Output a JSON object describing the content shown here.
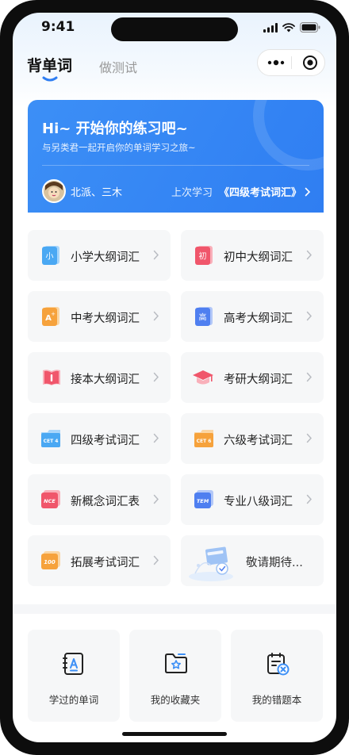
{
  "status": {
    "time": "9:41"
  },
  "tabs": {
    "active": "背单词",
    "inactive": "做测试"
  },
  "banner": {
    "title": "Hi~ 开始你的练习吧~",
    "subtitle": "与另类君一起开启你的单词学习之旅~",
    "authors": "北派、三木",
    "last_study_label": "上次学习",
    "last_study_book": "《四级考试词汇》"
  },
  "categories": [
    {
      "label": "小学大纲词汇",
      "icon": "xiao-icon",
      "icon_text": "小",
      "color": "#4aa8f3"
    },
    {
      "label": "初中大纲词汇",
      "icon": "chu-icon",
      "icon_text": "初",
      "color": "#f0566b"
    },
    {
      "label": "中考大纲词汇",
      "icon": "a-plus-icon",
      "icon_text": "A⁺",
      "color": "#f6a23c"
    },
    {
      "label": "高考大纲词汇",
      "icon": "gao-icon",
      "icon_text": "高",
      "color": "#4f7ff0"
    },
    {
      "label": "接本大纲词汇",
      "icon": "book-icon",
      "icon_text": "",
      "color": "#f0566b"
    },
    {
      "label": "考研大纲词汇",
      "icon": "graduation-cap-icon",
      "icon_text": "",
      "color": "#f0566b"
    },
    {
      "label": "四级考试词汇",
      "icon": "cet4-icon",
      "icon_text": "CET 4",
      "color": "#4aa8f3"
    },
    {
      "label": "六级考试词汇",
      "icon": "cet6-icon",
      "icon_text": "CET 6",
      "color": "#f6a23c"
    },
    {
      "label": "新概念词汇表",
      "icon": "nce-icon",
      "icon_text": "NCE",
      "color": "#f0566b"
    },
    {
      "label": "专业八级词汇",
      "icon": "tem-icon",
      "icon_text": "TEM",
      "color": "#4f7ff0"
    },
    {
      "label": "拓展考试词汇",
      "icon": "score-100-icon",
      "icon_text": "100",
      "color": "#f6a23c"
    },
    {
      "label": "敬请期待...",
      "icon": "coming-soon-illustration-icon",
      "icon_text": "",
      "color": "#9fc3f5"
    }
  ],
  "bottom": [
    {
      "label": "学过的单词",
      "icon": "learned-words-icon"
    },
    {
      "label": "我的收藏夹",
      "icon": "favorites-folder-icon"
    },
    {
      "label": "我的错题本",
      "icon": "mistake-book-icon"
    }
  ],
  "colors": {
    "accent": "#3c8ff6",
    "text": "#222222",
    "card_bg": "#f6f7f8"
  }
}
